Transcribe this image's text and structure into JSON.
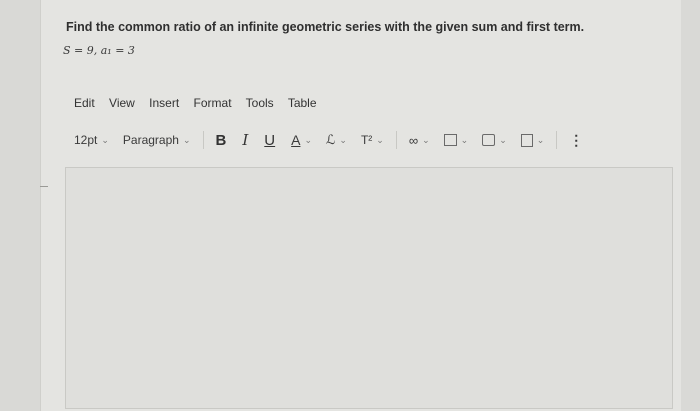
{
  "question": {
    "text": "Find the common ratio of an infinite geometric series with the given sum and first term.",
    "given": "S = 9, a₁ = 3"
  },
  "menubar": {
    "items": [
      "Edit",
      "View",
      "Insert",
      "Format",
      "Tools",
      "Table"
    ]
  },
  "toolbar": {
    "font_size": "12pt",
    "paragraph": "Paragraph",
    "bold": "B",
    "italic": "I",
    "underline": "U",
    "text_color": "A",
    "highlight": "ℒ",
    "superscript": "T²",
    "link": "∞",
    "more": "⋮"
  },
  "icons": [
    "chevron-down-icon",
    "link-icon",
    "image-icon",
    "media-icon",
    "document-icon",
    "more-vertical-icon"
  ]
}
